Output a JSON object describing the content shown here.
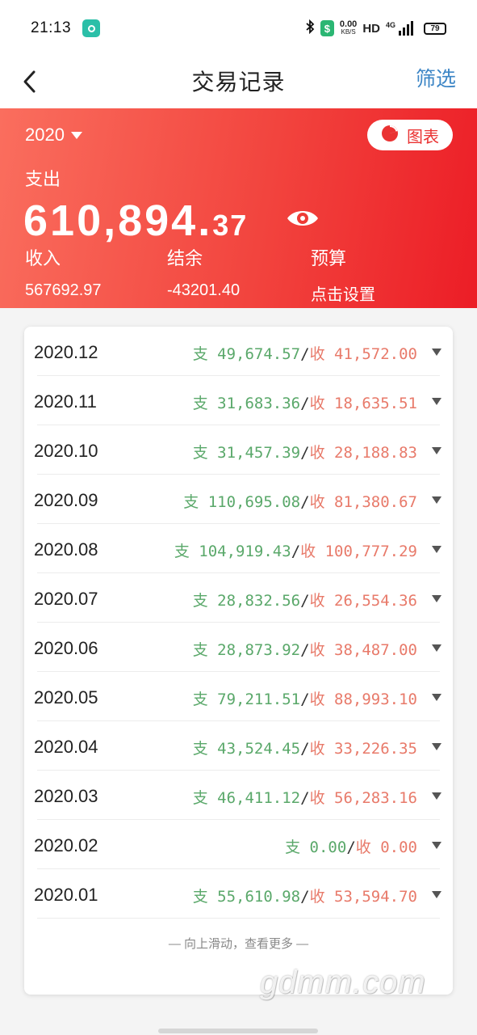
{
  "status_bar": {
    "time": "21:13",
    "net_speed_value": "0.00",
    "net_speed_unit": "KB/S",
    "hd": "HD",
    "network": "4G",
    "battery": "79"
  },
  "nav": {
    "title": "交易记录",
    "filter_label": "筛选"
  },
  "summary": {
    "year": "2020",
    "chart_button": "图表",
    "spend_label": "支出",
    "total_int": "610,894.",
    "total_dec": "37",
    "income_label": "收入",
    "income_value": "567692.97",
    "balance_label": "结余",
    "balance_value": "-43201.40",
    "budget_label": "预算",
    "budget_value": "点击设置"
  },
  "colors": {
    "header_gradient_start": "#fa6e5e",
    "header_gradient_end": "#ec1d26",
    "expense_green": "#5aa86a",
    "income_red": "#e87a6a",
    "link_blue": "#3d86c6"
  },
  "list": {
    "expense_prefix": "支",
    "income_prefix": "收",
    "separator": "/",
    "rows": [
      {
        "month": "2020.12",
        "expense": "49,674.57",
        "income": "41,572.00"
      },
      {
        "month": "2020.11",
        "expense": "31,683.36",
        "income": "18,635.51"
      },
      {
        "month": "2020.10",
        "expense": "31,457.39",
        "income": "28,188.83"
      },
      {
        "month": "2020.09",
        "expense": "110,695.08",
        "income": "81,380.67"
      },
      {
        "month": "2020.08",
        "expense": "104,919.43",
        "income": "100,777.29"
      },
      {
        "month": "2020.07",
        "expense": "28,832.56",
        "income": "26,554.36"
      },
      {
        "month": "2020.06",
        "expense": "28,873.92",
        "income": "38,487.00"
      },
      {
        "month": "2020.05",
        "expense": "79,211.51",
        "income": "88,993.10"
      },
      {
        "month": "2020.04",
        "expense": "43,524.45",
        "income": "33,226.35"
      },
      {
        "month": "2020.03",
        "expense": "46,411.12",
        "income": "56,283.16"
      },
      {
        "month": "2020.02",
        "expense": "0.00",
        "income": "0.00"
      },
      {
        "month": "2020.01",
        "expense": "55,610.98",
        "income": "53,594.70"
      }
    ],
    "footer_hint": "— 向上滑动，查看更多 —"
  },
  "watermark": "gdmm.com",
  "icons": [
    "back-arrow-icon",
    "dropdown-caret-icon",
    "pie-chart-icon",
    "eye-icon",
    "bluetooth-icon",
    "signal-icon",
    "battery-icon"
  ]
}
